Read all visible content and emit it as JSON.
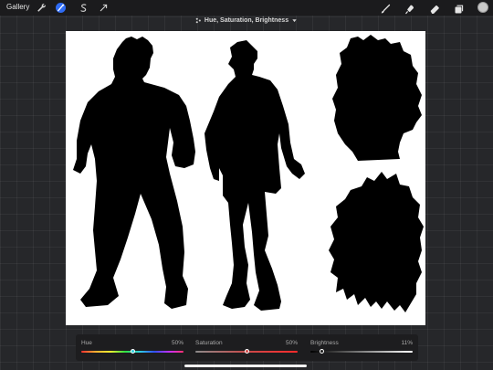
{
  "topbar": {
    "gallery_label": "Gallery",
    "left_tools": [
      "wrench-icon",
      "adjustments-wand-icon",
      "selection-s-icon",
      "transform-arrow-icon"
    ],
    "active_tool": "adjustments-wand-icon",
    "right_tools": [
      "brush-icon",
      "smudge-icon",
      "eraser-icon",
      "layers-icon"
    ],
    "active_color": "#c9c9c9"
  },
  "adjustment": {
    "title": "Hue, Saturation, Brightness"
  },
  "sliders": {
    "hue": {
      "label": "Hue",
      "value_text": "50%",
      "value": 0.5
    },
    "saturation": {
      "label": "Saturation",
      "value_text": "50%",
      "value": 0.5
    },
    "brightness": {
      "label": "Brightness",
      "value_text": "11%",
      "value": 0.11
    }
  },
  "colors": {
    "accent": "#2f6cf5",
    "background": "#26272a",
    "canvas": "#ffffff",
    "silhouette": "#000000"
  }
}
